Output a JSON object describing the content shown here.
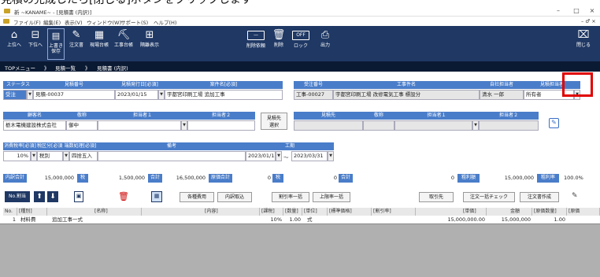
{
  "caption": "見積の完成したら[閉じる]ボタンをクリックします",
  "window": {
    "title": "新 ~KANAME~ - [見積書 (内訳)]",
    "min": "–",
    "max": "□",
    "close": "×"
  },
  "menu": {
    "items": [
      "ファイル(F)",
      "編集(E)",
      "表示(V)",
      "ウィンドウ(W)",
      "サポート(S)",
      "ヘルプ(H)"
    ],
    "right": "– ♂ ×"
  },
  "toolbar": {
    "up": "上位へ",
    "down": "下位へ",
    "save": "上書き\n保存",
    "order": "注文書",
    "site": "現場台帳",
    "work": "工事台帳",
    "hidden": "隔離表示",
    "delreq": "削除依頼",
    "delete": "削除",
    "lock": "ロック",
    "lock_state": "OFF",
    "output": "出力",
    "close": "閉じる"
  },
  "breadcrumb": {
    "top": "TOPメニュー",
    "sep1": "》",
    "list": "見積一覧",
    "sep2": "》",
    "current": "見積書 (内訳)"
  },
  "row1": {
    "h_status": "ステータス",
    "h_estno": "見積番号",
    "h_issue": "見積発行日[必須]",
    "h_case": "案件名[必須]",
    "status": "受注",
    "estno": "見積-00037",
    "issue": "2023/01/15",
    "case": "宇都宮印刷工場  追加工事",
    "h_orderno": "受注番号",
    "h_work": "工事件名",
    "h_staff": "自社担当者",
    "h_estowner": "見積担当者",
    "orderno": "工事-00027",
    "work": "宇都宮印刷工場  改修電気工事  標設分",
    "staff": "清水  一郎",
    "owner": "所有者"
  },
  "row2": {
    "h_client": "顧客名",
    "h_honor": "敬称",
    "h_person1": "担当者１",
    "h_person2": "担当者２",
    "client": "栃木電機建設株式会社",
    "honor": "御中",
    "estdest_btn": "見積先\n選択",
    "h_dest": "見積先",
    "h_honor2": "敬称",
    "h_dperson1": "担当者１",
    "h_dperson2": "担当者２"
  },
  "row3": {
    "h_tax": "消費税率[必須]",
    "h_taxdiv": "税区分[必須]",
    "h_round": "端数処理[必須]",
    "h_note": "備考",
    "h_period": "工期",
    "tax": "10%",
    "taxdiv": "税別",
    "round": "四捨五入",
    "from": "2023/01/15",
    "tilde": "～",
    "to": "2023/03/31"
  },
  "summary": {
    "l_inner": "内訳合計",
    "inner": "15,000,000",
    "l_tax": "税",
    "tax": "1,500,000",
    "l_total": "合計",
    "total": "16,500,000",
    "l_cost": "原価合計",
    "cost": "0",
    "l_tax2": "税",
    "tax2": "0",
    "l_total2": "合計",
    "total2": "0",
    "l_profit": "粗利額",
    "profit": "15,000,000",
    "l_rate": "粗利率",
    "rate": "100.0%"
  },
  "actions": {
    "renumber": "No.割当",
    "expenses": "各種費用",
    "inner_cap": "内訳取込",
    "discount_all": "割引率一括",
    "upper_all": "上限率一括",
    "supplier": "取引先",
    "order_check": "注文一括チェック",
    "order_create": "注文書作成"
  },
  "grid": {
    "headers": [
      "No.",
      "[種別]",
      "[名称]",
      "[内容]",
      "[課税]",
      "[数量]",
      "[単位]",
      "[標準価格]",
      "[割引率]",
      "[単価]",
      "金額",
      "[原価数量]",
      "[原価"
    ],
    "rows": [
      [
        "1",
        "材料費",
        "追加工事一式",
        "",
        "10%",
        "1.00",
        "式",
        "",
        "",
        "15,000,000.00",
        "15,000,000",
        "1.00",
        ""
      ]
    ]
  }
}
